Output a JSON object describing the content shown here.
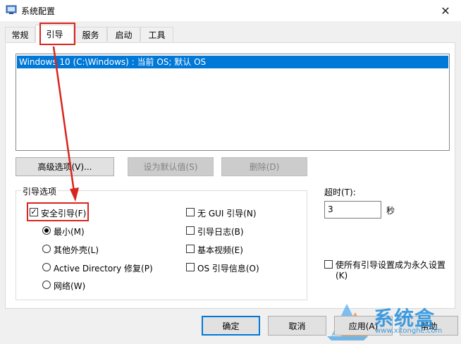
{
  "window": {
    "title": "系统配置",
    "close_glyph": "✕"
  },
  "tabs": [
    {
      "label": "常规"
    },
    {
      "label": "引导",
      "active": true
    },
    {
      "label": "服务"
    },
    {
      "label": "启动"
    },
    {
      "label": "工具"
    }
  ],
  "boot_list": {
    "items": [
      "Windows 10 (C:\\Windows) : 当前 OS; 默认 OS"
    ]
  },
  "buttons": {
    "advanced": "高级选项(V)...",
    "set_default": "设为默认值(S)",
    "delete": "删除(D)"
  },
  "boot_options": {
    "group_label": "引导选项",
    "safe_boot": {
      "label": "安全引导(F)",
      "checked": true
    },
    "minimal": {
      "label": "最小(M)",
      "selected": true
    },
    "alternate_shell": {
      "label": "其他外壳(L)"
    },
    "active_directory": {
      "label": "Active Directory 修复(P)"
    },
    "network": {
      "label": "网络(W)"
    },
    "no_gui": {
      "label": "无 GUI 引导(N)",
      "checked": false
    },
    "boot_log": {
      "label": "引导日志(B)",
      "checked": false
    },
    "base_video": {
      "label": "基本视频(E)",
      "checked": false
    },
    "os_boot_info": {
      "label": "OS 引导信息(O)",
      "checked": false
    }
  },
  "timeout": {
    "label": "超时(T):",
    "value": "3",
    "unit": "秒"
  },
  "permanent": {
    "label_line1": "使所有引导设置成为永久设置",
    "label_line2": "(K)",
    "checked": false
  },
  "footer_buttons": {
    "ok": "确定",
    "cancel": "取消",
    "apply": "应用(A)",
    "help": "帮助"
  },
  "watermark": {
    "text": "系统盒",
    "url": "www.xitonghe.com"
  },
  "colors": {
    "selection": "#0078d7",
    "annotation_red": "#d9251d",
    "watermark_blue": "#1f8fe0"
  }
}
